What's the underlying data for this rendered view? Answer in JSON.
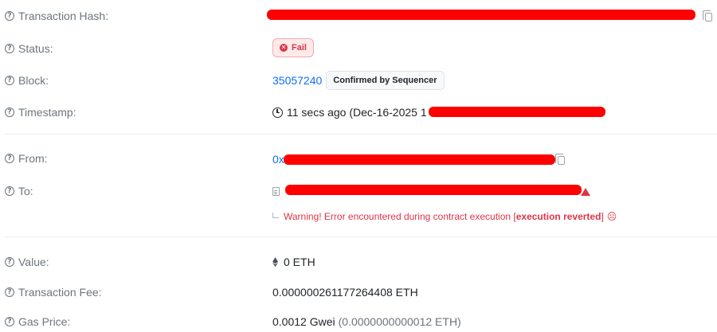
{
  "rows": {
    "tx_hash": {
      "label": "Transaction Hash:"
    },
    "status": {
      "label": "Status:",
      "badge": "Fail"
    },
    "block": {
      "label": "Block:",
      "number": "35057240",
      "badge": "Confirmed by Sequencer"
    },
    "timestamp": {
      "label": "Timestamp:",
      "text": "11 secs ago (Dec-16-2025 1"
    },
    "from": {
      "label": "From:",
      "prefix": "0x"
    },
    "to": {
      "label": "To:",
      "warning_prefix": "Warning! Error encountered during contract execution [",
      "warning_bold": "execution reverted",
      "warning_suffix": "]"
    },
    "value": {
      "label": "Value:",
      "amount": "0 ETH"
    },
    "fee": {
      "label": "Transaction Fee:",
      "amount": "0.000000261177264408 ETH"
    },
    "gas_price": {
      "label": "Gas Price:",
      "amount": "0.0012 Gwei",
      "sub": "(0.0000000000012 ETH)"
    }
  },
  "icons": {
    "help": "question-circle",
    "copy": "copy",
    "fail": "x-circle",
    "clock": "clock",
    "contract": "document",
    "alert": "warning-triangle",
    "sad": "frown-face",
    "eth": "ethereum"
  },
  "colors": {
    "label": "#6c757d",
    "link": "#0d6efd",
    "danger": "#dc3545",
    "redaction": "#ff0000"
  }
}
